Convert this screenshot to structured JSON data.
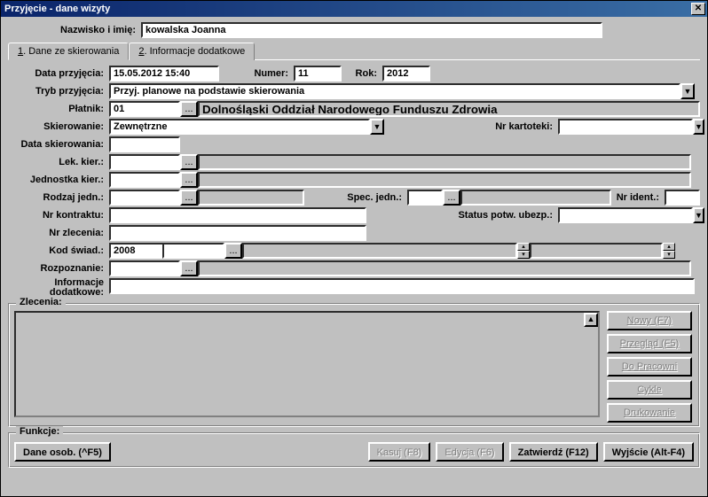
{
  "window": {
    "title": "Przyjęcie - dane wizyty"
  },
  "header": {
    "name_label": "Nazwisko i imię:",
    "name_value": "kowalska Joanna"
  },
  "tabs": {
    "t1_prefix": "1",
    "t1_label": ". Dane ze skierowania",
    "t2_prefix": "2",
    "t2_label": ". Informacje dodatkowe"
  },
  "form": {
    "data_przyjecia_label": "Data przyjęcia:",
    "data_przyjecia": "15.05.2012 15:40",
    "numer_label": "Numer:",
    "numer": "11",
    "rok_label": "Rok:",
    "rok": "2012",
    "tryb_label": "Tryb przyjęcia:",
    "tryb": "Przyj. planowe na podstawie skierowania",
    "platnik_label": "Płatnik:",
    "platnik_code": "01",
    "platnik_desc": "Dolnośląski Oddział Narodowego Funduszu Zdrowia",
    "skierowanie_label": "Skierowanie:",
    "skierowanie": "Zewnętrzne",
    "nr_kartoteki_label": "Nr kartoteki:",
    "data_sk_label": "Data skierowania:",
    "lek_kier_label": "Lek. kier.:",
    "jedn_kier_label": "Jednostka kier.:",
    "rodzaj_jedn_label": "Rodzaj jedn.:",
    "spec_jedn_label": "Spec. jedn.:",
    "nr_ident_label": "Nr ident.:",
    "nr_kontraktu_label": "Nr kontraktu:",
    "status_potw_label": "Status potw. ubezp.:",
    "nr_zlecenia_label": "Nr zlecenia:",
    "kod_swiad_label": "Kod świad.:",
    "kod_swiad": "2008",
    "rozpoznanie_label": "Rozpoznanie:",
    "info_dod_label1": "Informacje",
    "info_dod_label2": "dodatkowe:"
  },
  "zlecenia": {
    "legend": "Zlecenia:",
    "buttons": {
      "nowy": "Nowy (F7)",
      "przeglad": "Przegląd (F5)",
      "do_pracowni": "Do Pracowni",
      "cykle": "Cykle",
      "drukowanie": "Drukowanie"
    }
  },
  "funkcje": {
    "legend": "Funkcje:",
    "dane_osob": "Dane osob. (^F5)",
    "kasuj": "Kasuj (F8)",
    "edycja": "Edycja (F6)",
    "zatwierdz": "Zatwierdź (F12)",
    "wyjscie": "Wyjście (Alt-F4)"
  },
  "glyph": {
    "ellipsis": "...",
    "down": "▼",
    "up": "▲",
    "close": "✕"
  }
}
